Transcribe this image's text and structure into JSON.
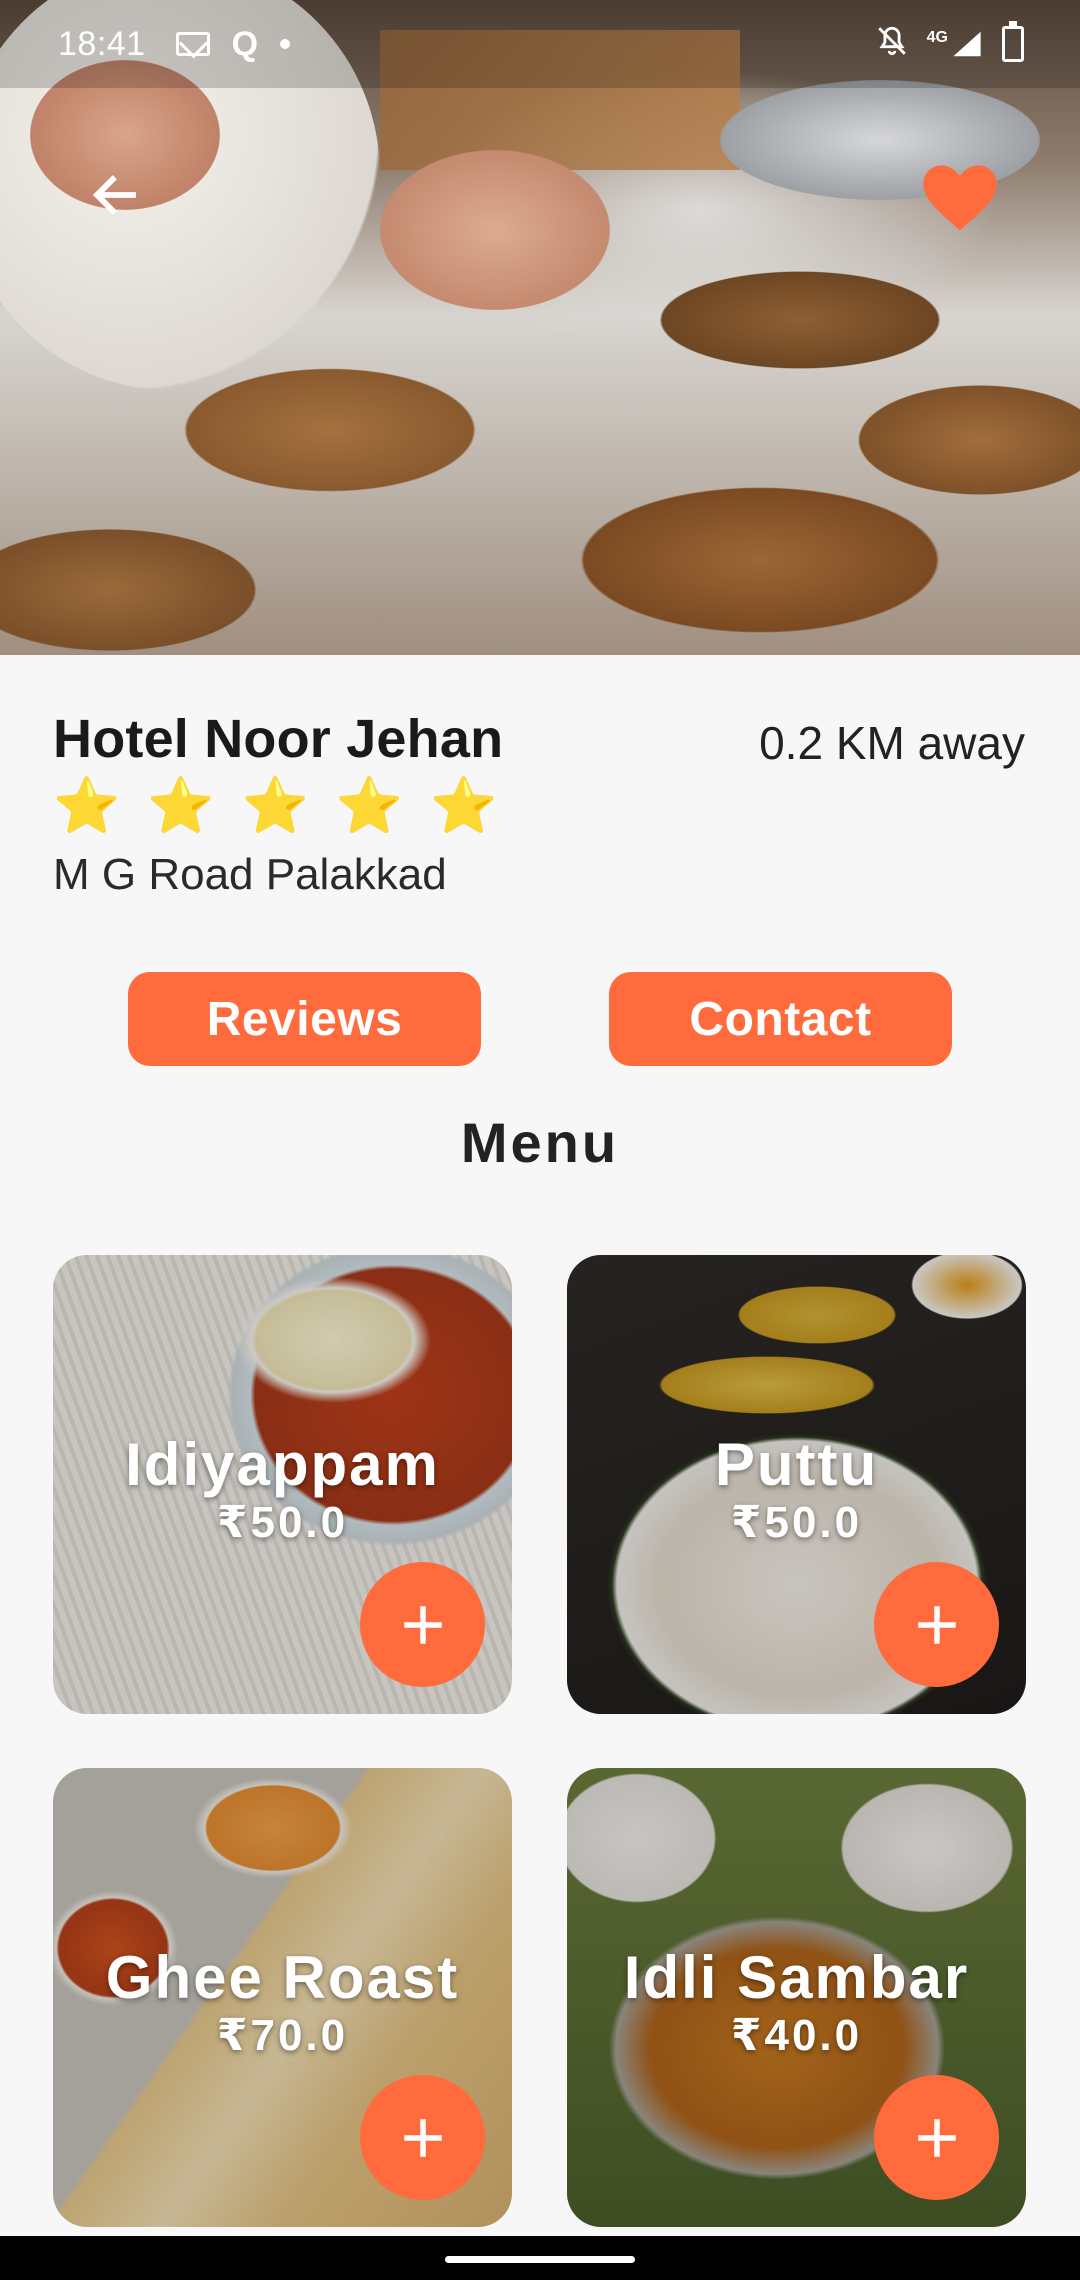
{
  "status_bar": {
    "time": "18:41",
    "left_icons": [
      "mail-icon",
      "q-icon",
      "dot-icon"
    ],
    "q_glyph": "Q",
    "right_icons": [
      "mute-icon",
      "signal-4g-icon",
      "battery-charging-icon"
    ],
    "network_label": "4G"
  },
  "header": {
    "back_icon": "arrow-left-icon",
    "favorite_icon": "heart-icon",
    "favorite_color": "#ff6b3d"
  },
  "restaurant": {
    "name": "Hotel Noor Jehan",
    "distance": "0.2 KM away",
    "rating": 5,
    "stars": [
      "⭐",
      "⭐",
      "⭐",
      "⭐",
      "⭐"
    ],
    "address": "M G Road Palakkad"
  },
  "actions": {
    "reviews_label": "Reviews",
    "contact_label": "Contact"
  },
  "menu": {
    "title": "Menu",
    "items": [
      {
        "name": "Idiyappam",
        "price": "₹50.0"
      },
      {
        "name": "Puttu",
        "price": "₹50.0"
      },
      {
        "name": "Ghee Roast",
        "price": "₹70.0"
      },
      {
        "name": "Idli Sambar",
        "price": "₹40.0"
      }
    ]
  },
  "theme": {
    "accent": "#ff6b3d",
    "background": "#f7f7f7"
  }
}
